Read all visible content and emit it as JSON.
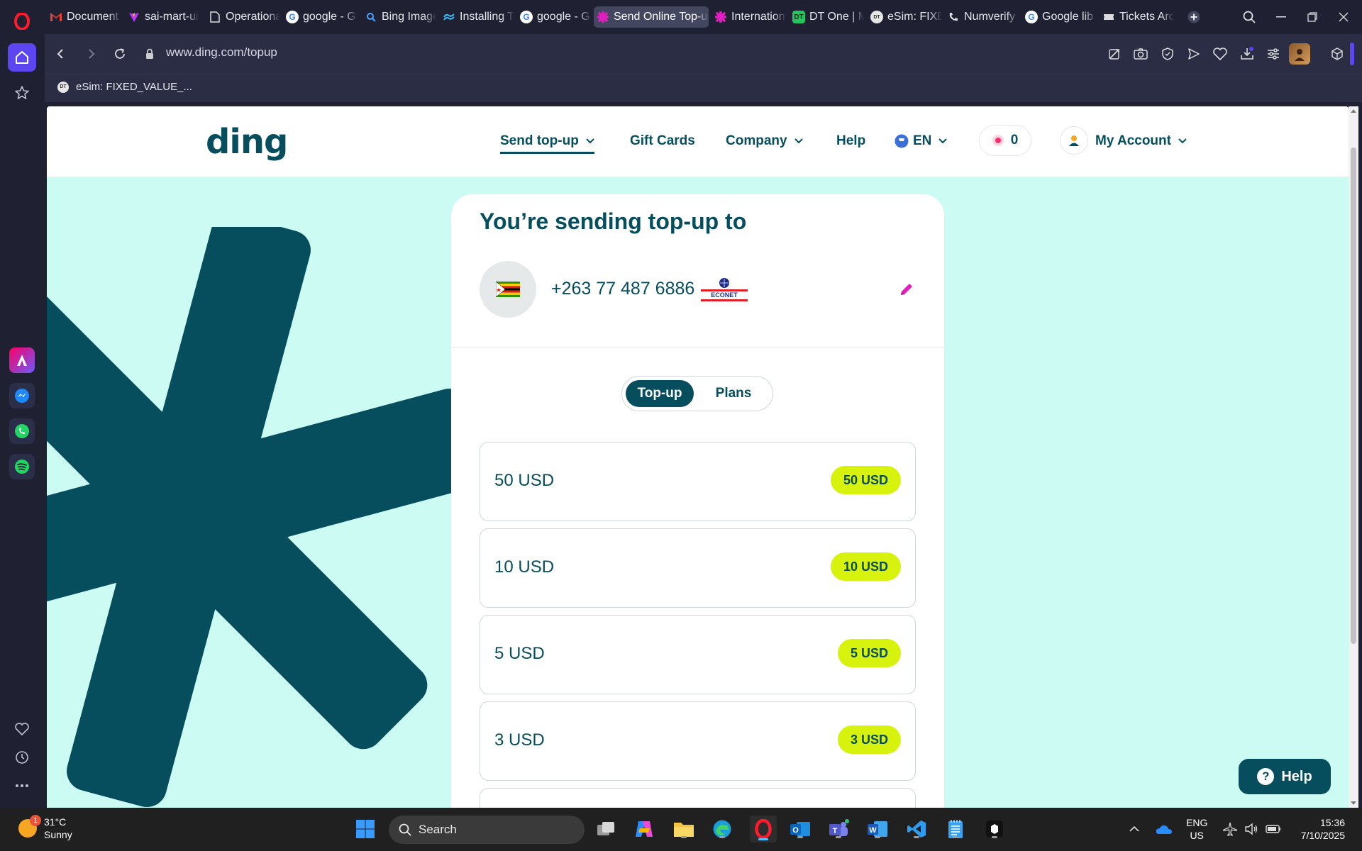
{
  "browser": {
    "tabs": [
      {
        "label": "Document",
        "icon": "gmail-icon"
      },
      {
        "label": "sai-mart-ui",
        "icon": "vite-icon"
      },
      {
        "label": "Operationa",
        "icon": "document-icon"
      },
      {
        "label": "google - G",
        "icon": "google-icon"
      },
      {
        "label": "Bing Image",
        "icon": "bing-search-icon"
      },
      {
        "label": "Installing T",
        "icon": "tailwind-icon"
      },
      {
        "label": "google - G",
        "icon": "google-icon"
      },
      {
        "label": "Send Online Top-up",
        "icon": "ding-icon"
      },
      {
        "label": "Internation",
        "icon": "ding-icon"
      },
      {
        "label": "DT One | M",
        "icon": "dtone-icon"
      },
      {
        "label": "eSim: FIXED",
        "icon": "dt-icon"
      },
      {
        "label": "Numverify",
        "icon": "phone-icon"
      },
      {
        "label": "Google lib",
        "icon": "google-icon"
      },
      {
        "label": "Tickets Arc",
        "icon": "tickets-icon"
      }
    ],
    "active_tab_index": 7,
    "url": "www.ding.com/topup",
    "bookmark": "eSim: FIXED_VALUE_..."
  },
  "site": {
    "logo": "ding",
    "nav": {
      "send_topup": "Send top-up",
      "gift_cards": "Gift Cards",
      "company": "Company",
      "help": "Help",
      "language": "EN",
      "points": "0",
      "account": "My Account"
    }
  },
  "topup": {
    "title": "You’re sending top-up to",
    "phone": "+263 77 487 6886",
    "operator": "ECONET",
    "tabs": {
      "topup": "Top-up",
      "plans": "Plans"
    },
    "amounts": [
      {
        "label": "50 USD",
        "badge": "50 USD"
      },
      {
        "label": "10 USD",
        "badge": "10 USD"
      },
      {
        "label": "5 USD",
        "badge": "5 USD"
      },
      {
        "label": "3 USD",
        "badge": "3 USD"
      }
    ],
    "help_button": "Help"
  },
  "taskbar": {
    "weather_temp": "31°C",
    "weather_desc": "Sunny",
    "weather_badge": "1",
    "search_placeholder": "Search",
    "lang_line1": "ENG",
    "lang_line2": "US",
    "time": "15:36",
    "date": "7/10/2025"
  },
  "colors": {
    "brand_dark": "#064d5e",
    "brand_mint": "#cbfbf3",
    "badge_lime": "#d7f20d",
    "opera_accent": "#5b46f2"
  }
}
